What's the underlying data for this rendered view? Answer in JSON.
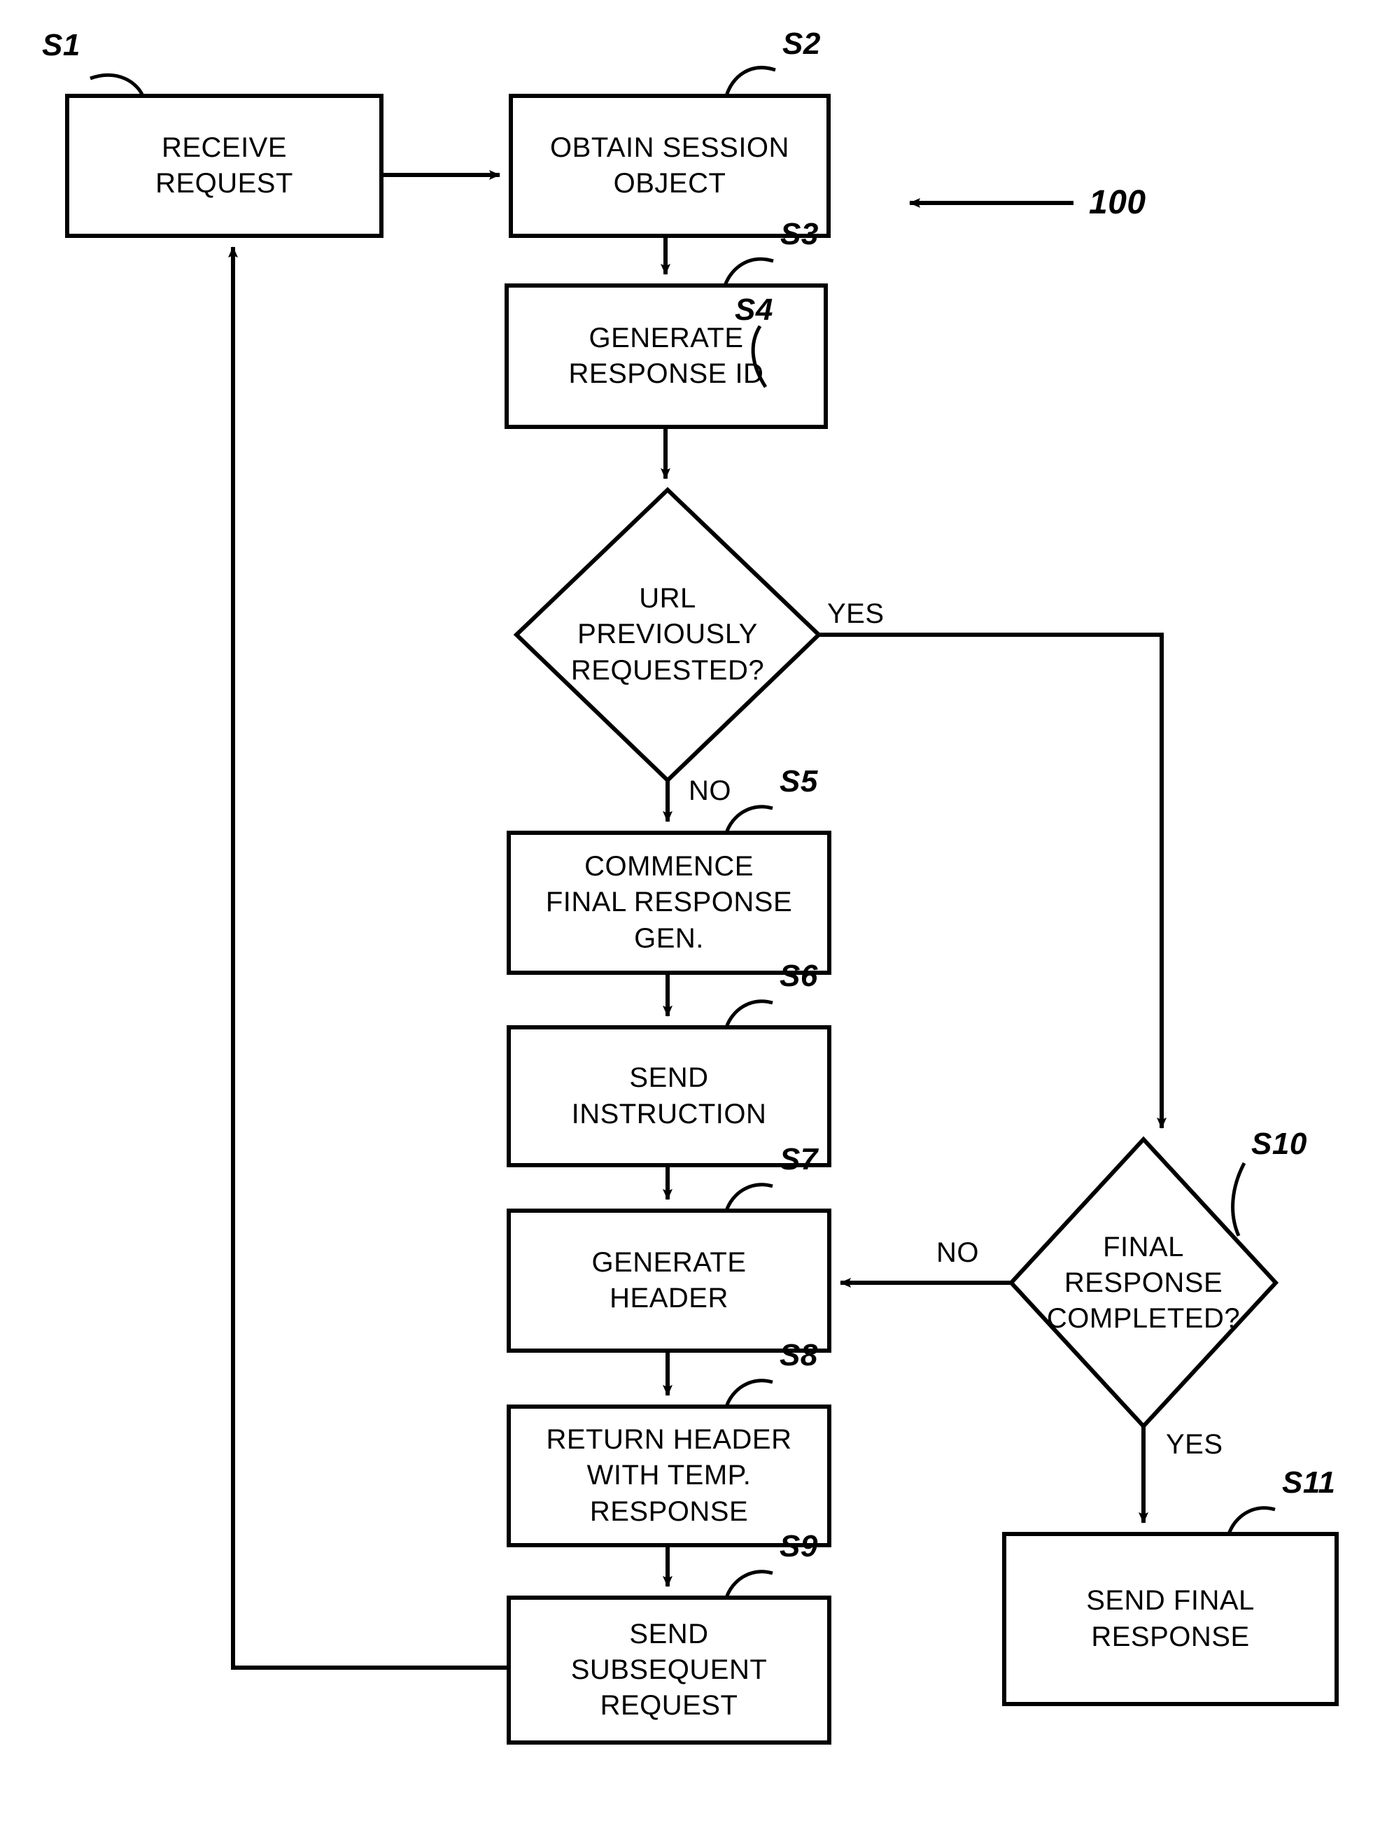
{
  "figure": {
    "type": "flowchart",
    "reference_numeral": "100",
    "orientation": "portrait",
    "line_color": "#000000",
    "background_color": "#ffffff"
  },
  "nodes": [
    {
      "id": "S1",
      "ref": "S1",
      "shape": "process",
      "text": "RECEIVE\nREQUEST"
    },
    {
      "id": "S2",
      "ref": "S2",
      "shape": "process",
      "text": "OBTAIN SESSION\nOBJECT"
    },
    {
      "id": "S3",
      "ref": "S3",
      "shape": "process",
      "text": "GENERATE\nRESPONSE ID"
    },
    {
      "id": "S4",
      "ref": "S4",
      "shape": "decision",
      "text": "URL\nPREVIOUSLY\nREQUESTED?"
    },
    {
      "id": "S5",
      "ref": "S5",
      "shape": "process",
      "text": "COMMENCE\nFINAL RESPONSE\nGEN."
    },
    {
      "id": "S6",
      "ref": "S6",
      "shape": "process",
      "text": "SEND\nINSTRUCTION"
    },
    {
      "id": "S7",
      "ref": "S7",
      "shape": "process",
      "text": "GENERATE\nHEADER"
    },
    {
      "id": "S8",
      "ref": "S8",
      "shape": "process",
      "text": "RETURN HEADER\nWITH TEMP.\nRESPONSE"
    },
    {
      "id": "S9",
      "ref": "S9",
      "shape": "process",
      "text": "SEND\nSUBSEQUENT\nREQUEST"
    },
    {
      "id": "S10",
      "ref": "S10",
      "shape": "decision",
      "text": "FINAL\nRESPONSE\nCOMPLETED?"
    },
    {
      "id": "S11",
      "ref": "S11",
      "shape": "process",
      "text": "SEND FINAL\nRESPONSE"
    }
  ],
  "edge_labels": {
    "s4_yes": "YES",
    "s4_no": "NO",
    "s10_no": "NO",
    "s10_yes": "YES"
  },
  "edges": [
    {
      "from": "S1",
      "to": "S2",
      "label": ""
    },
    {
      "from": "S2",
      "to": "S3",
      "label": ""
    },
    {
      "from": "S3",
      "to": "S4",
      "label": ""
    },
    {
      "from": "S4",
      "to": "S10",
      "label": "YES"
    },
    {
      "from": "S4",
      "to": "S5",
      "label": "NO"
    },
    {
      "from": "S5",
      "to": "S6",
      "label": ""
    },
    {
      "from": "S6",
      "to": "S7",
      "label": ""
    },
    {
      "from": "S7",
      "to": "S8",
      "label": ""
    },
    {
      "from": "S8",
      "to": "S9",
      "label": ""
    },
    {
      "from": "S9",
      "to": "S1",
      "label": ""
    },
    {
      "from": "S10",
      "to": "S7",
      "label": "NO"
    },
    {
      "from": "S10",
      "to": "S11",
      "label": "YES"
    }
  ]
}
